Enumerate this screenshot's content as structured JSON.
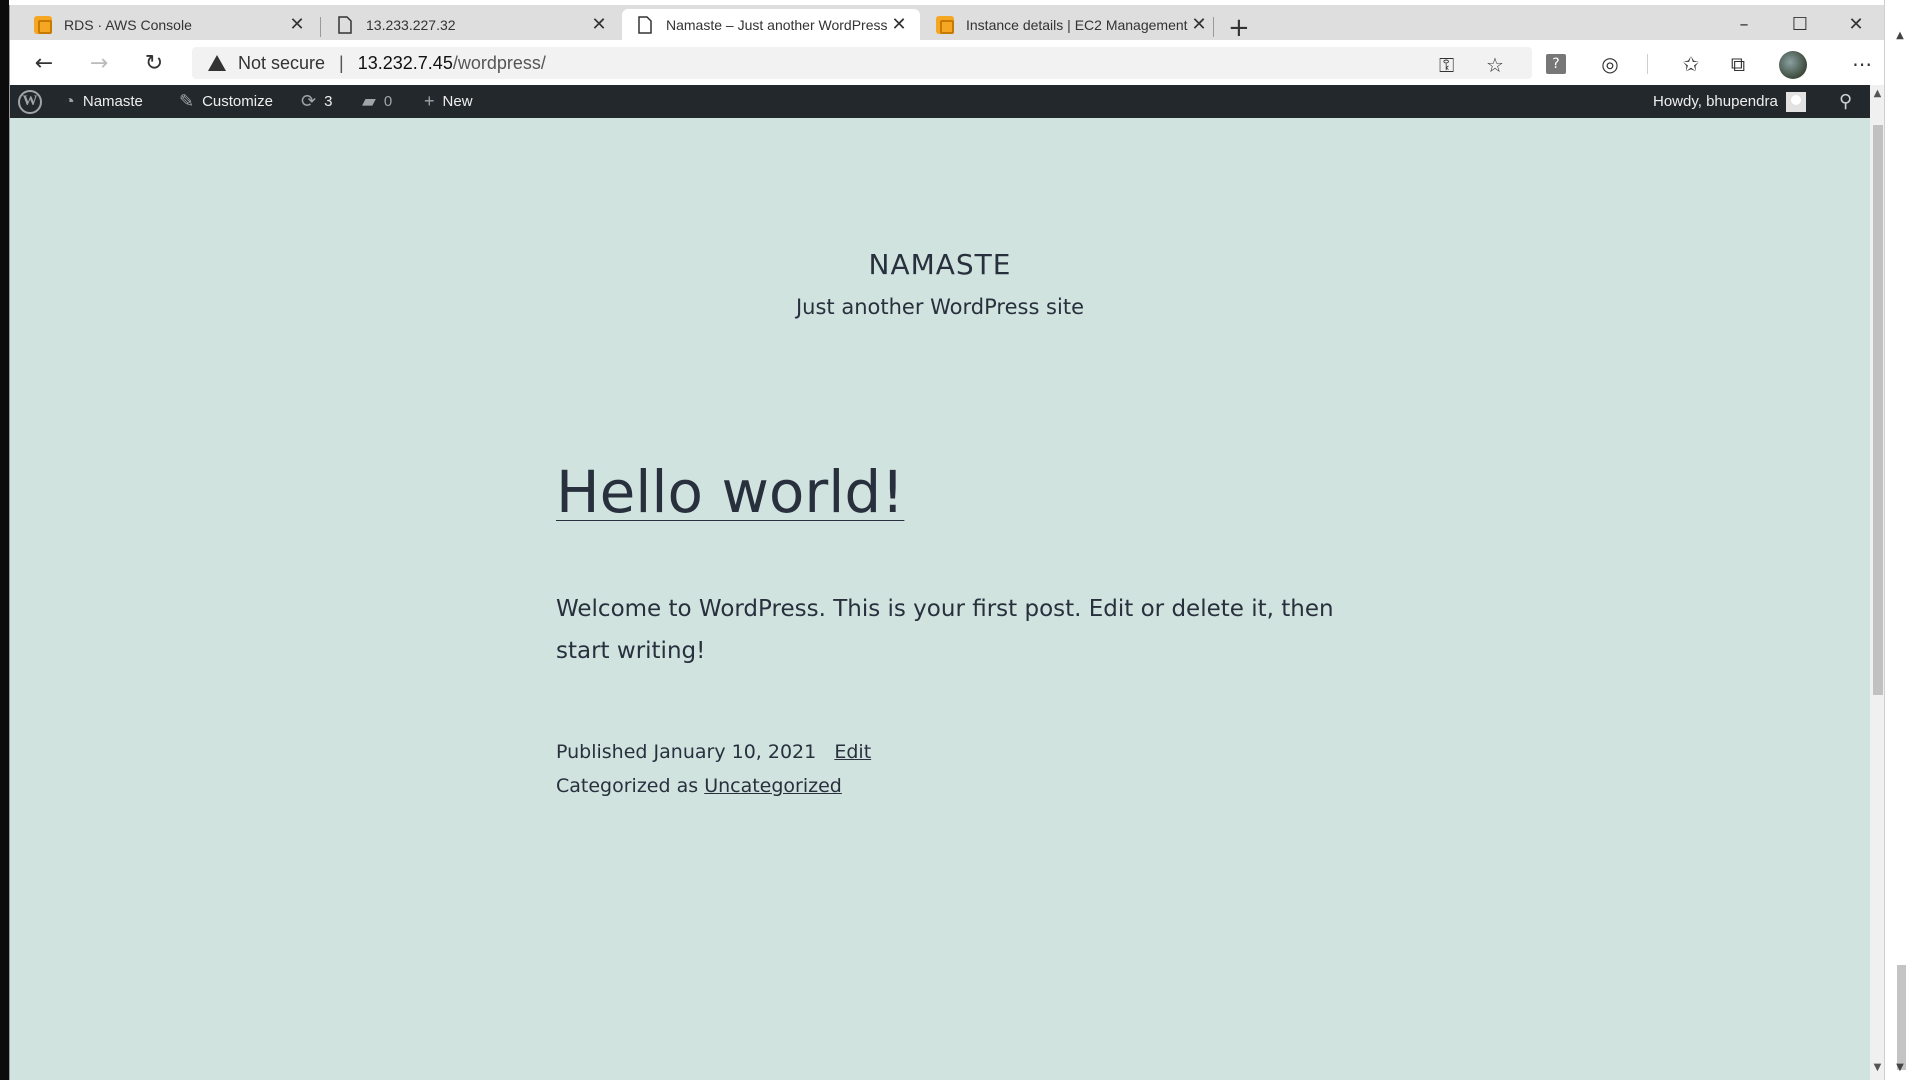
{
  "browser": {
    "tabs": [
      {
        "title": "RDS · AWS Console",
        "icon": "aws-icon",
        "active": false
      },
      {
        "title": "13.233.227.32",
        "icon": "page-icon",
        "active": false
      },
      {
        "title": "Namaste – Just another WordPress site",
        "icon": "page-icon",
        "active": true
      },
      {
        "title": "Instance details | EC2 Management Console",
        "icon": "aws-icon",
        "active": false
      }
    ],
    "new_tab_label": "+",
    "address": {
      "security_label": "Not secure",
      "separator": "|",
      "host": "13.232.7.45",
      "path": "/wordpress/"
    },
    "toolbar_icons": [
      "key-icon",
      "star-icon",
      "help-icon",
      "extension-icon",
      "favorites-icon",
      "collections-icon",
      "profile-avatar",
      "more-icon"
    ]
  },
  "wp_admin_bar": {
    "site_name": "Namaste",
    "customize_label": "Customize",
    "updates_count": "3",
    "comments_count": "0",
    "new_label": "New",
    "howdy": "Howdy, bhupendra"
  },
  "site": {
    "title": "NAMASTE",
    "tagline": "Just another WordPress site"
  },
  "post": {
    "title": "Hello world!",
    "body": "Welcome to WordPress. This is your first post. Edit or delete it, then start writing!",
    "published_label": "Published",
    "date": "January 10, 2021",
    "edit_label": "Edit",
    "categorized_label": "Categorized as",
    "category": "Uncategorized"
  },
  "colors": {
    "page_background": "#d0e3df",
    "admin_bar": "#23282d",
    "text": "#28303d"
  }
}
